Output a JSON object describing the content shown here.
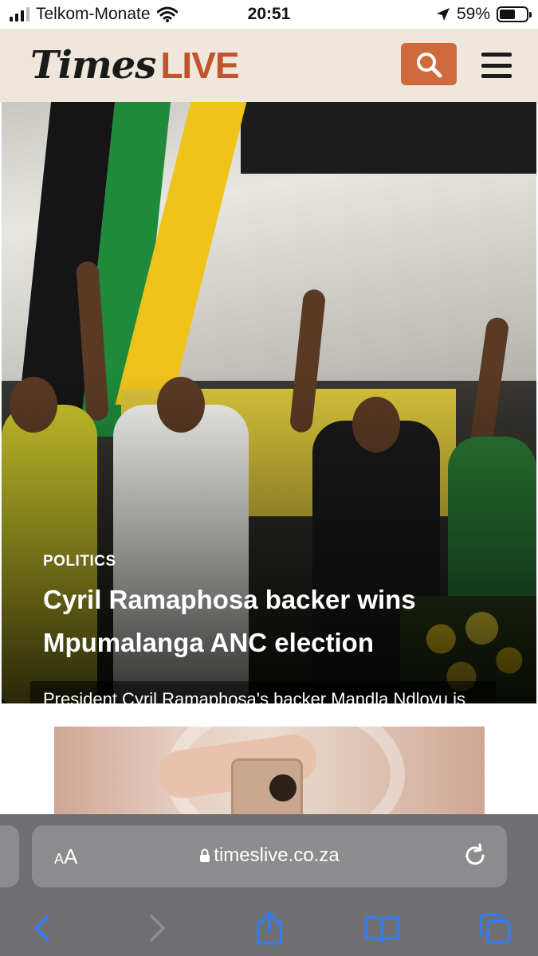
{
  "status_bar": {
    "carrier": "Telkom-Monate",
    "time": "20:51",
    "battery_percent": "59%",
    "battery_level": 0.59,
    "icons": [
      "signal-icon",
      "wifi-icon",
      "location-arrow-icon",
      "battery-icon"
    ]
  },
  "header": {
    "logo_times": "Times",
    "logo_live": "LIVE",
    "accent_color": "#cf6a3c",
    "background_color": "#efe7dc",
    "icons": [
      "search-icon",
      "hamburger-menu-icon"
    ]
  },
  "hero": {
    "category": "POLITICS",
    "title": "Cyril Ramaphosa backer wins Mpumalanga ANC election",
    "summary": "President Cyril Ramaphosa's backer Mandla Ndlovu is the new provincial chairperson of the ANC in Mpumalanga."
  },
  "browser": {
    "text_size_label_small": "A",
    "text_size_label_large": "A",
    "url": "timeslive.co.za",
    "icons": [
      "lock-icon",
      "reload-icon",
      "back-arrow-icon",
      "forward-arrow-icon",
      "share-icon",
      "bookmarks-icon",
      "tabs-icon"
    ]
  }
}
